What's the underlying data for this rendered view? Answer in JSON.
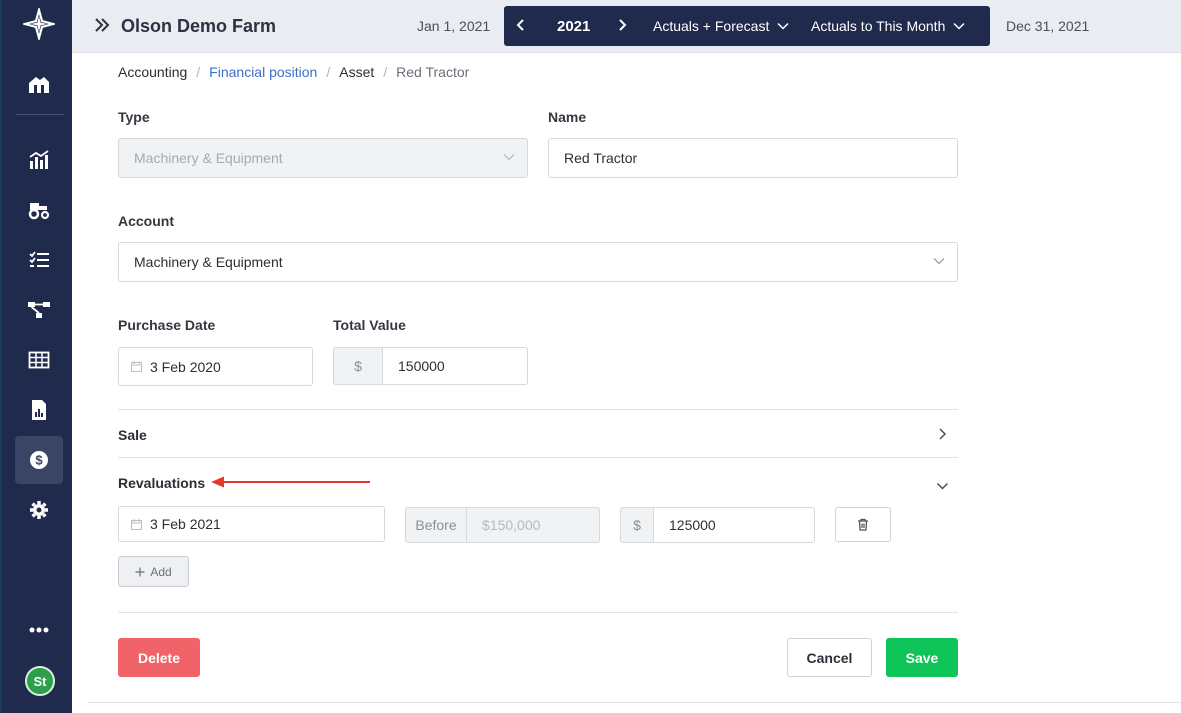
{
  "topbar": {
    "farm_name": "Olson Demo Farm",
    "date_start": "Jan 1, 2021",
    "date_end": "Dec 31, 2021",
    "year": "2021",
    "mode": "Actuals + Forecast",
    "range": "Actuals to This Month"
  },
  "sidebar": {
    "items": [
      {
        "icon": "logo-icon"
      },
      {
        "icon": "farm-home-icon"
      },
      {
        "icon": "analytics-chart-icon"
      },
      {
        "icon": "tractor-icon"
      },
      {
        "icon": "task-list-icon"
      },
      {
        "icon": "workflow-icon"
      },
      {
        "icon": "table-grid-icon"
      },
      {
        "icon": "report-icon"
      },
      {
        "icon": "dollar-icon",
        "active": true
      },
      {
        "icon": "gear-icon"
      },
      {
        "icon": "more-icon"
      }
    ],
    "avatar": "St"
  },
  "breadcrumb": {
    "root": "Accounting",
    "section": "Financial position",
    "type": "Asset",
    "current": "Red Tractor"
  },
  "form": {
    "type_label": "Type",
    "type_value": "Machinery & Equipment",
    "name_label": "Name",
    "name_value": "Red Tractor",
    "account_label": "Account",
    "account_value": "Machinery & Equipment",
    "purchase_date_label": "Purchase Date",
    "purchase_date_value": "3 Feb 2020",
    "total_value_label": "Total Value",
    "currency_symbol": "$",
    "total_value": "150000"
  },
  "sale": {
    "title": "Sale"
  },
  "revaluations": {
    "title": "Revaluations",
    "rows": [
      {
        "date": "3 Feb 2021",
        "before_label": "Before",
        "before_value": "$150,000",
        "currency_symbol": "$",
        "amount": "125000"
      }
    ],
    "add_label": "Add"
  },
  "actions": {
    "delete": "Delete",
    "cancel": "Cancel",
    "save": "Save"
  },
  "colors": {
    "sidebar": "#1f2a4d",
    "delete": "#ef6369",
    "save": "#0fc55a",
    "link": "#3b6fc9",
    "annotation_arrow": "#e8352a"
  }
}
